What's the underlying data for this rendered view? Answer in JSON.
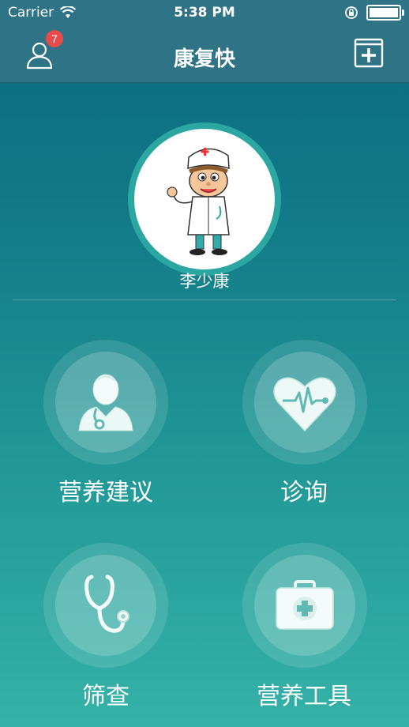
{
  "status_bar": {
    "carrier": "Carrier",
    "time": "5:38 PM"
  },
  "nav": {
    "title": "康复快",
    "badge_count": "7",
    "user_icon": "user-icon",
    "add_icon": "plus-box-icon"
  },
  "profile": {
    "name": "李少康",
    "avatar_icon": "doctor-cartoon-avatar"
  },
  "menu": {
    "items": [
      {
        "label": "营养建议",
        "icon": "doctor-icon"
      },
      {
        "label": "诊询",
        "icon": "heart-pulse-icon"
      },
      {
        "label": "筛查",
        "icon": "stethoscope-icon"
      },
      {
        "label": "营养工具",
        "icon": "first-aid-kit-icon"
      }
    ]
  },
  "colors": {
    "nav_bg": "#2f7386",
    "gradient_top": "#0a6a80",
    "gradient_bottom": "#35b2a8",
    "badge": "#e84b4b"
  }
}
